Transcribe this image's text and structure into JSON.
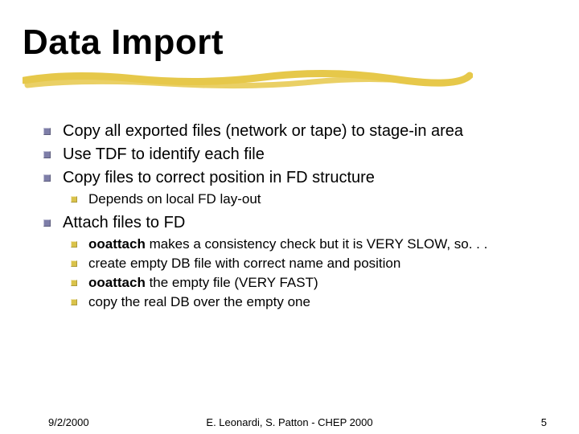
{
  "title": "Data Import",
  "bullets": {
    "b1": "Copy all exported files (network or tape) to stage-in area",
    "b2": "Use TDF to identify each file",
    "b3": "Copy files to correct position in FD structure",
    "b3_1": "Depends on local FD lay-out",
    "b4": "Attach files to FD",
    "b4_1_bold": "ooattach",
    "b4_1_rest": " makes a consistency check but it is VERY SLOW, so. . .",
    "b4_2": "create empty DB file with correct name and position",
    "b4_3_bold": "ooattach",
    "b4_3_rest": " the empty file (VERY FAST)",
    "b4_4": "copy the real DB over the empty one"
  },
  "footer": {
    "date": "9/2/2000",
    "center": "E. Leonardi, S. Patton - CHEP 2000",
    "page": "5"
  }
}
